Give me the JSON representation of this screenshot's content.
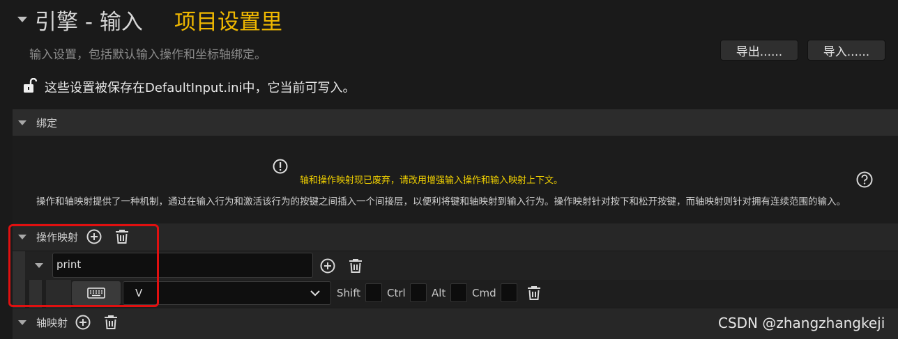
{
  "header": {
    "title": "引擎 - 输入",
    "subtitle": "项目设置里",
    "description": "输入设置，包括默认输入操作和坐标轴绑定。",
    "export_label": "导出......",
    "import_label": "导入......",
    "save_note": "这些设置被保存在DefaultInput.ini中，它当前可写入。"
  },
  "bindings": {
    "label": "绑定",
    "warning": "轴和操作映射现已废弃，请改用增强输入操作和输入映射上下文。",
    "description": "操作和轴映射提供了一种机制，通过在输入行为和激活该行为的按键之间插入一个间接层，以便利将键和轴映射到输入行为。操作映射针对按下和松开按键，而轴映射则针对拥有连续范围的输入。"
  },
  "action_mappings": {
    "label": "操作映射",
    "mapping": {
      "name": "print",
      "key": "V",
      "modifiers": [
        "Shift",
        "Ctrl",
        "Alt",
        "Cmd"
      ]
    }
  },
  "axis_mappings": {
    "label": "轴映射"
  },
  "watermark": "CSDN @zhangzhangkeji",
  "colors": {
    "accent": "#f0b800",
    "warning": "#f0d000",
    "highlight": "#e01010",
    "background": "#1a1a1a"
  }
}
